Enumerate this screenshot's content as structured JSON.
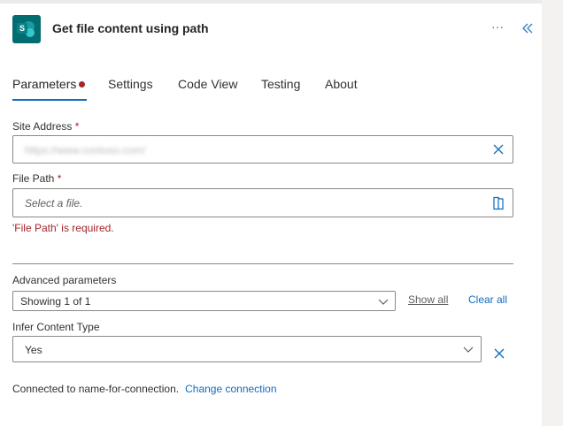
{
  "header": {
    "title": "Get file content using path",
    "app_icon_letter": "S",
    "more_label": "···"
  },
  "tabs": [
    {
      "label": "Parameters",
      "active": true,
      "has_error_dot": true
    },
    {
      "label": "Settings"
    },
    {
      "label": "Code View"
    },
    {
      "label": "Testing"
    },
    {
      "label": "About"
    }
  ],
  "site_address": {
    "label": "Site Address",
    "required_mark": "*",
    "value": "https://www.contoso.com/"
  },
  "file_path": {
    "label": "File Path",
    "required_mark": "*",
    "placeholder": "Select a file.",
    "error": "'File Path' is required."
  },
  "advanced": {
    "label": "Advanced parameters",
    "dropdown_value": "Showing 1 of 1",
    "show_all": "Show all",
    "clear_all": "Clear all"
  },
  "infer_content_type": {
    "label": "Infer Content Type",
    "value": "Yes"
  },
  "footer": {
    "connected_text": "Connected to name-for-connection.",
    "change_connection": "Change connection"
  },
  "colors": {
    "accent": "#0f6cbd",
    "error": "#a4262c",
    "sharepoint": "#036c70"
  }
}
